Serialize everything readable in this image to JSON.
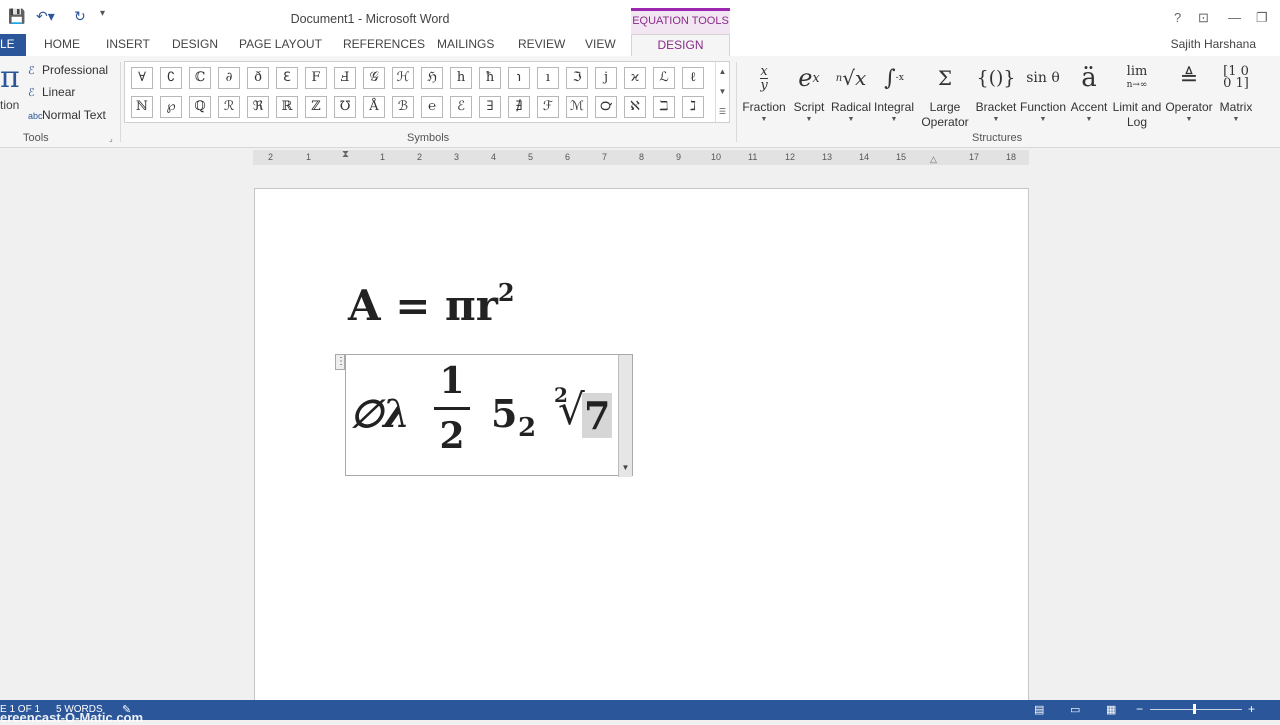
{
  "window": {
    "title": "Document1 - Microsoft Word",
    "context_tab_group": "EQUATION TOOLS",
    "controls": [
      "?",
      "⊡",
      "—",
      "❐"
    ]
  },
  "quick_access": {
    "save_icon": "save-icon",
    "undo_icon": "undo-icon",
    "redo_icon": "redo-icon",
    "customize_icon": "customize-icon"
  },
  "tabs": {
    "file": "LE",
    "items": [
      "HOME",
      "INSERT",
      "DESIGN",
      "PAGE LAYOUT",
      "REFERENCES",
      "MAILINGS",
      "REVIEW",
      "VIEW"
    ],
    "active": "DESIGN",
    "user": "Sajith Harshana"
  },
  "tools_group": {
    "partial_label": "tion",
    "items": [
      "Professional",
      "Linear",
      "Normal Text"
    ],
    "label": "Tools"
  },
  "symbols_group": {
    "label": "Symbols",
    "row1": [
      "∀",
      "∁",
      "ℂ",
      "∂",
      "ð",
      "ℇ",
      "F",
      "Ⅎ",
      "𝒢",
      "ℋ",
      "ℌ",
      "h",
      "ħ",
      "℩",
      "ı",
      "ℑ",
      "j",
      "ϰ",
      "ℒ",
      "ℓ"
    ],
    "row2": [
      "ℕ",
      "℘",
      "ℚ",
      "ℛ",
      "ℜ",
      "ℝ",
      "ℤ",
      "℧",
      "Å",
      "ℬ",
      "℮",
      "ℰ",
      "∃",
      "∄",
      "ℱ",
      "ℳ",
      "℺",
      "ℵ",
      "ℶ",
      "ℷ"
    ]
  },
  "structures_group": {
    "label": "Structures",
    "items": [
      {
        "label": "Fraction",
        "label2": ""
      },
      {
        "label": "Script",
        "label2": ""
      },
      {
        "label": "Radical",
        "label2": ""
      },
      {
        "label": "Integral",
        "label2": ""
      },
      {
        "label": "Large",
        "label2": "Operator"
      },
      {
        "label": "Bracket",
        "label2": ""
      },
      {
        "label": "Function",
        "label2": ""
      },
      {
        "label": "Accent",
        "label2": ""
      },
      {
        "label": "Limit and",
        "label2": "Log"
      },
      {
        "label": "Operator",
        "label2": ""
      },
      {
        "label": "Matrix",
        "label2": ""
      }
    ]
  },
  "ruler": {
    "numbers": [
      "2",
      "1",
      "1",
      "2",
      "3",
      "4",
      "5",
      "6",
      "7",
      "8",
      "9",
      "10",
      "11",
      "12",
      "13",
      "14",
      "15",
      "17",
      "18"
    ]
  },
  "document": {
    "equation1": {
      "base": "A = πr",
      "exponent": "2"
    },
    "equation2": {
      "symbols": "∅λ",
      "numerator": "1",
      "denominator": "2",
      "base": "5",
      "subscript": "2",
      "root_index": "2",
      "radicand": "7"
    }
  },
  "status": {
    "pages": "E 1 OF 1",
    "words": "5 WORDS",
    "watermark": "ereencast-O-Matic.com"
  }
}
